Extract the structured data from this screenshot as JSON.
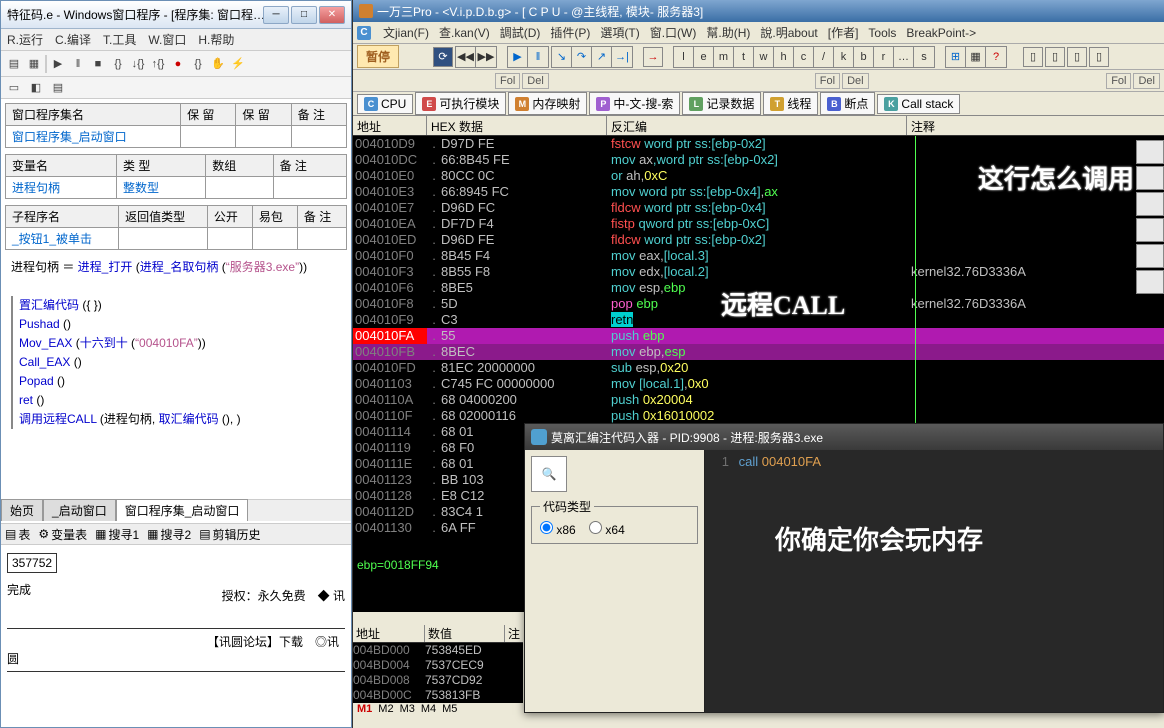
{
  "left": {
    "title": "特征码.e - Windows窗口程序 - [程序集: 窗口程…",
    "menu": [
      "R.运行",
      "C.编译",
      "T.工具",
      "W.窗口",
      "H.帮助"
    ],
    "table1": {
      "row1": [
        "窗口程序集名",
        "保 留",
        "保 留",
        "备 注"
      ],
      "row2": "窗口程序集_启动窗口"
    },
    "table2": {
      "row1": [
        "变量名",
        "类 型",
        "数组",
        "备 注"
      ],
      "vname": "进程句柄",
      "vtype": "整数型"
    },
    "table3": {
      "row1": [
        "子程序名",
        "返回值类型",
        "公开",
        "易包",
        "备 注"
      ],
      "sname": "_按钮1_被单击"
    },
    "stmt": "进程句柄 ＝ 进程_打开 (进程_名取句柄 (“服务器3.exe”))",
    "code": [
      {
        "t": "置汇编代码 ({  })",
        "cls": ""
      },
      {
        "t": "Pushad ()",
        "cls": ""
      },
      {
        "t": "Mov_EAX (十六到十 (“004010FA”))",
        "cls": ""
      },
      {
        "t": "Call_EAX ()",
        "cls": ""
      },
      {
        "t": "Popad ()",
        "cls": ""
      },
      {
        "t": "ret ()",
        "cls": ""
      },
      {
        "t": "调用远程CALL (进程句柄, 取汇编代码 (), )",
        "cls": ""
      }
    ],
    "tabs": [
      "始页",
      "_启动窗口",
      "窗口程序集_启动窗口"
    ],
    "bottom_toolbar": [
      "表",
      "变量表",
      "搜寻1",
      "搜寻2",
      "剪辑历史"
    ],
    "status": {
      "box1": "357752",
      "done": "完成",
      "auth": "授权：永久免费　◆ 讯",
      "forum": "【讯圆论坛】下载　◎讯圆"
    }
  },
  "right": {
    "title": "一万三Pro - <V.i.p.D.b.g> - [ C P U  - @主线程, 模块- 服务器3]",
    "menu": [
      "文jian(F)",
      "查.kan(V)",
      "調試(D)",
      "插件(P)",
      "選項(T)",
      "窗.口(W)",
      "幫.助(H)",
      "說.明about",
      "[作者]",
      "Tools",
      "BreakPoint->"
    ],
    "pause": "暂停",
    "letter_btns": [
      "l",
      "e",
      "m",
      "t",
      "w",
      "h",
      "c",
      "/",
      "k",
      "b",
      "r",
      "…",
      "s"
    ],
    "fol": "Fol",
    "del": "Del",
    "tabs": [
      {
        "b": "C",
        "t": "CPU"
      },
      {
        "b": "E",
        "t": "可执行模块"
      },
      {
        "b": "M",
        "t": "内存映射"
      },
      {
        "b": "P",
        "t": "中-文-搜-索"
      },
      {
        "b": "L",
        "t": "记录数据"
      },
      {
        "b": "T",
        "t": "线程"
      },
      {
        "b": "B",
        "t": "断点"
      },
      {
        "b": "K",
        "t": "Call stack"
      }
    ],
    "headers": {
      "addr": "地址",
      "hex": "HEX 数据",
      "dis": "反汇编",
      "cmt": "注释"
    },
    "rows": [
      {
        "a": "004010D9",
        "h": "D97D FE",
        "d": [
          [
            "fstcw ",
            "c-red"
          ],
          [
            "word ptr ss:[ebp-0x2]",
            "c-cyan"
          ]
        ]
      },
      {
        "a": "004010DC",
        "h": "66:8B45 FE",
        "d": [
          [
            "mov ",
            "c-cyan"
          ],
          [
            "ax",
            ""
          ],
          [
            ",",
            "c-cyan"
          ],
          [
            "word ptr ss:[ebp-0x2]",
            "c-cyan"
          ]
        ]
      },
      {
        "a": "004010E0",
        "h": "80CC 0C",
        "d": [
          [
            "or ",
            "c-cyan"
          ],
          [
            "ah",
            ""
          ],
          [
            ",",
            ""
          ],
          [
            "0xC",
            "c-yellow"
          ]
        ]
      },
      {
        "a": "004010E3",
        "h": "66:8945 FC",
        "d": [
          [
            "mov ",
            "c-cyan"
          ],
          [
            "word ptr ss:[ebp-0x4]",
            "c-cyan"
          ],
          [
            ",",
            ""
          ],
          [
            "ax",
            "c-green"
          ]
        ]
      },
      {
        "a": "004010E7",
        "h": "D96D FC",
        "d": [
          [
            "fldcw ",
            "c-red"
          ],
          [
            "word ptr ss:[ebp-0x4]",
            "c-cyan"
          ]
        ]
      },
      {
        "a": "004010EA",
        "h": "DF7D F4",
        "d": [
          [
            "fistp ",
            "c-red"
          ],
          [
            "qword ptr ss:[ebp-0xC]",
            "c-cyan"
          ]
        ]
      },
      {
        "a": "004010ED",
        "h": "D96D FE",
        "d": [
          [
            "fldcw ",
            "c-red"
          ],
          [
            "word ptr ss:[ebp-0x2]",
            "c-cyan"
          ]
        ]
      },
      {
        "a": "004010F0",
        "h": "8B45 F4",
        "d": [
          [
            "mov ",
            "c-cyan"
          ],
          [
            "eax",
            ""
          ],
          [
            ",",
            ""
          ],
          [
            "[local.3]",
            "c-cyan"
          ]
        ]
      },
      {
        "a": "004010F3",
        "h": "8B55 F8",
        "d": [
          [
            "mov ",
            "c-cyan"
          ],
          [
            "edx",
            ""
          ],
          [
            ",",
            ""
          ],
          [
            "[local.2]",
            "c-cyan"
          ]
        ],
        "c": "kernel32.76D3336A"
      },
      {
        "a": "004010F6",
        "h": "8BE5",
        "d": [
          [
            "mov ",
            "c-cyan"
          ],
          [
            "esp",
            ""
          ],
          [
            ",",
            ""
          ],
          [
            "ebp",
            "c-green"
          ]
        ]
      },
      {
        "a": "004010F8",
        "h": "5D",
        "d": [
          [
            "pop ",
            "c-pink"
          ],
          [
            "ebp",
            "c-green"
          ]
        ],
        "c": "kernel32.76D3336A"
      },
      {
        "a": "004010F9",
        "h": "C3",
        "d": [
          [
            "retn",
            "c-cyan",
            true
          ]
        ]
      },
      {
        "a": "004010FA",
        "h": "55",
        "d": [
          [
            "push ",
            "c-cyan"
          ],
          [
            "ebp",
            "c-green"
          ]
        ],
        "sel": 2,
        "hladdr": true
      },
      {
        "a": "004010FB",
        "h": "8BEC",
        "d": [
          [
            "mov ",
            "c-cyan"
          ],
          [
            "ebp",
            ""
          ],
          [
            ",",
            ""
          ],
          [
            "esp",
            "c-green"
          ]
        ],
        "sel": 1
      },
      {
        "a": "004010FD",
        "h": "81EC 20000000",
        "d": [
          [
            "sub ",
            "c-cyan"
          ],
          [
            "esp",
            ""
          ],
          [
            ",",
            ""
          ],
          [
            "0x20",
            "c-yellow"
          ]
        ]
      },
      {
        "a": "00401103",
        "h": "C745 FC 00000000",
        "d": [
          [
            "mov ",
            "c-cyan"
          ],
          [
            "[local.1]",
            "c-cyan"
          ],
          [
            ",",
            ""
          ],
          [
            "0x0",
            "c-yellow"
          ]
        ]
      },
      {
        "a": "0040110A",
        "h": "68 04000200",
        "d": [
          [
            "push ",
            "c-cyan"
          ],
          [
            "0x20004",
            "c-yellow"
          ]
        ]
      },
      {
        "a": "0040110F",
        "h": "68 02000116",
        "d": [
          [
            "push ",
            "c-cyan"
          ],
          [
            "0x16010002",
            "c-yellow"
          ]
        ]
      },
      {
        "a": "00401114",
        "h": "68 01",
        "d": []
      },
      {
        "a": "00401119",
        "h": "68 F0",
        "d": []
      },
      {
        "a": "0040111E",
        "h": "68 01",
        "d": []
      },
      {
        "a": "00401123",
        "h": "BB 103",
        "d": []
      },
      {
        "a": "00401128",
        "h": "E8 C12",
        "d": []
      },
      {
        "a": "0040112D",
        "h": "83C4 1",
        "d": []
      },
      {
        "a": "00401130",
        "h": "6A FF",
        "d": []
      }
    ],
    "statusline": "ebp=0018FF94",
    "annotation1": "这行怎么调用",
    "annotation2": "远程CALL",
    "dump": {
      "headers": [
        "地址",
        "数值",
        "注"
      ],
      "rows": [
        {
          "a": "004BD000",
          "v": "753845ED"
        },
        {
          "a": "004BD004",
          "v": "7537CEC9"
        },
        {
          "a": "004BD008",
          "v": "7537CD92"
        },
        {
          "a": "004BD00C",
          "v": "753813FB"
        }
      ]
    },
    "m_tabs": [
      "M1",
      "M2",
      "M3",
      "M4",
      "M5"
    ]
  },
  "popup": {
    "title": "莫离汇编注代码入器 - PID:9908 - 进程:服务器3.exe",
    "group": "代码类型",
    "r1": "x86",
    "r2": "x64",
    "code": {
      "ln": "1",
      "call": "call",
      "addr": "004010FA"
    },
    "overlay": "你确定你会玩内存"
  }
}
